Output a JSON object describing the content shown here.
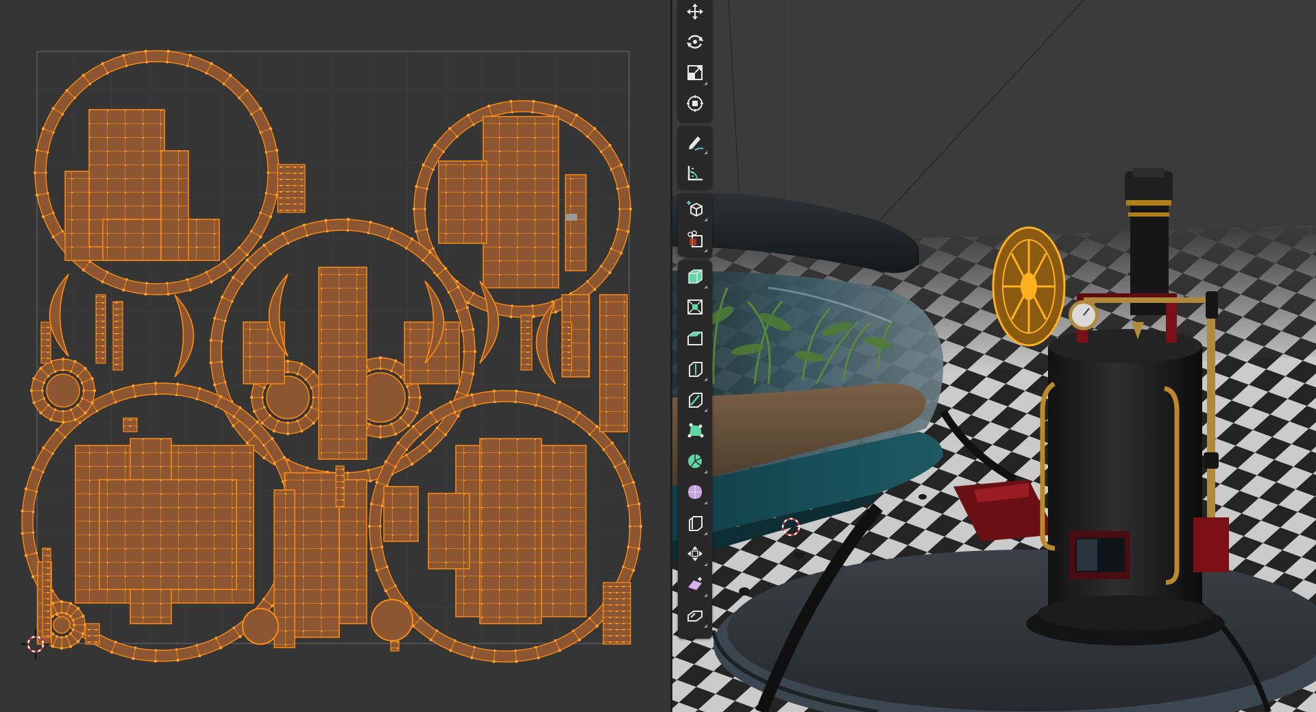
{
  "uv_editor": {
    "background": "#353535",
    "grid_color": "#3e3e3e",
    "bounds_color": "#5d5d5d",
    "island_fill": "#8b5631",
    "island_edge": "#ff8c10",
    "vertex": "#ffa030"
  },
  "viewport": {
    "background": "#3a3a3a",
    "floor": "checkerboard",
    "tools": [
      {
        "group": "transform",
        "name": "move-tool-icon"
      },
      {
        "group": "transform",
        "name": "rotate-tool-icon"
      },
      {
        "group": "transform",
        "name": "scale-tool-icon"
      },
      {
        "group": "transform",
        "name": "transform-tool-icon"
      },
      {
        "group": "annotate",
        "name": "annotate-tool-icon"
      },
      {
        "group": "annotate",
        "name": "measure-tool-icon"
      },
      {
        "group": "add",
        "name": "add-cube-tool-icon"
      },
      {
        "group": "add",
        "name": "cursor-cut-tool-icon"
      },
      {
        "group": "edit",
        "name": "extrude-region-tool-icon"
      },
      {
        "group": "edit",
        "name": "inset-faces-tool-icon"
      },
      {
        "group": "edit",
        "name": "bevel-tool-icon"
      },
      {
        "group": "edit",
        "name": "loop-cut-tool-icon"
      },
      {
        "group": "edit",
        "name": "knife-tool-icon"
      },
      {
        "group": "edit",
        "name": "poly-build-tool-icon"
      },
      {
        "group": "edit",
        "name": "spin-tool-icon"
      },
      {
        "group": "edit",
        "name": "smooth-tool-icon"
      },
      {
        "group": "edit",
        "name": "edge-slide-tool-icon"
      },
      {
        "group": "edit",
        "name": "shrink-fatten-tool-icon"
      },
      {
        "group": "edit",
        "name": "shear-tool-icon"
      },
      {
        "group": "edit",
        "name": "rip-region-tool-icon"
      }
    ]
  }
}
